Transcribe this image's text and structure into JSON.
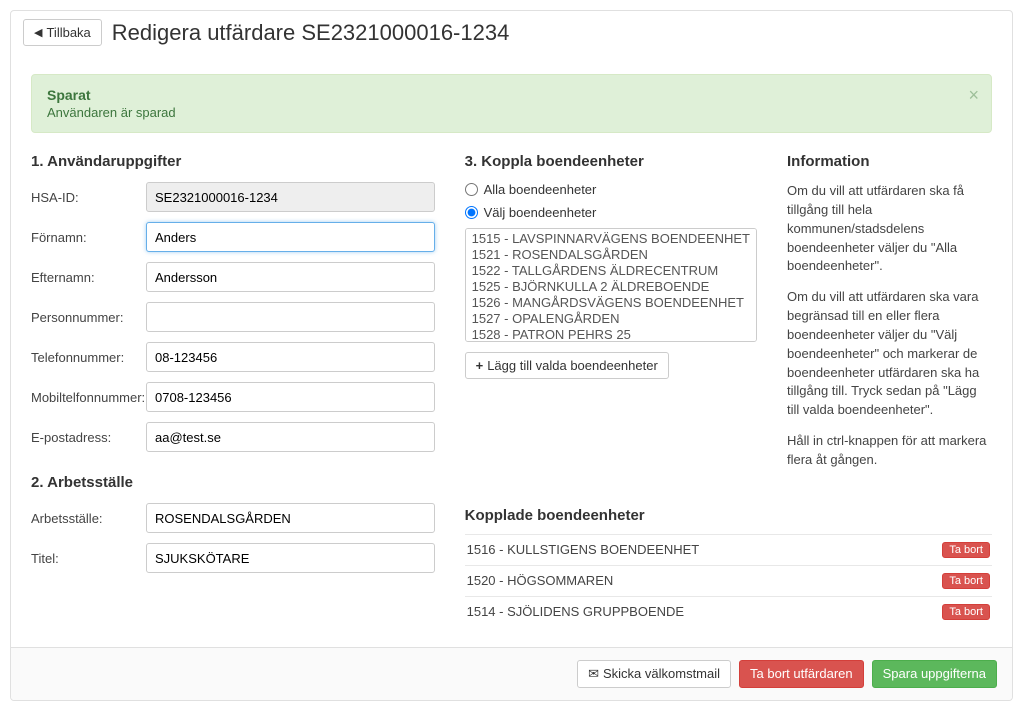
{
  "header": {
    "back_label": "Tillbaka",
    "title": "Redigera utfärdare SE2321000016-1234"
  },
  "alert": {
    "title": "Sparat",
    "text": "Användaren är sparad"
  },
  "section1": {
    "heading": "1. Användaruppgifter",
    "hsaid_label": "HSA-ID:",
    "hsaid_value": "SE2321000016-1234",
    "firstname_label": "Förnamn:",
    "firstname_value": "Anders",
    "lastname_label": "Efternamn:",
    "lastname_value": "Andersson",
    "personnr_label": "Personnummer:",
    "personnr_value": "",
    "phone_label": "Telefonnummer:",
    "phone_value": "08-123456",
    "mobile_label": "Mobiltelfonnummer:",
    "mobile_value": "0708-123456",
    "email_label": "E-postadress:",
    "email_value": "aa@test.se"
  },
  "section2": {
    "heading": "2. Arbetsställe",
    "workplace_label": "Arbetsställe:",
    "workplace_value": "ROSENDALSGÅRDEN",
    "title_label": "Titel:",
    "title_value": "SJUKSKÖTARE"
  },
  "section3": {
    "heading": "3. Koppla boendeenheter",
    "radio_all": "Alla boendeenheter",
    "radio_select": "Välj boendeenheter",
    "options": [
      "1515 - LAVSPINNARVÄGENS BOENDEENHET",
      "1521 - ROSENDALSGÅRDEN",
      "1522 - TALLGÅRDENS ÄLDRECENTRUM",
      "1525 - BJÖRNKULLA 2 ÄLDREBOENDE",
      "1526 - MANGÅRDSVÄGENS BOENDEENHET",
      "1527 - OPALENGÅRDEN",
      "1528 - PATRON PEHRS 25"
    ],
    "add_button": "Lägg till valda boendeenheter"
  },
  "info": {
    "heading": "Information",
    "p1": "Om du vill att utfärdaren ska få tillgång till hela kommunen/stadsdelens boendeenheter väljer du \"Alla boendeenheter\".",
    "p2": "Om du vill att utfärdaren ska vara begränsad till en eller flera boendeenheter väljer du \"Välj boendeenheter\" och markerar de boendeenheter utfärdaren ska ha tillgång till. Tryck sedan på \"Lägg till valda boendeenheter\".",
    "p3": "Håll in ctrl-knappen för att markera flera åt gången."
  },
  "linked": {
    "heading": "Kopplade boendeenheter",
    "remove_label": "Ta bort",
    "items": [
      "1516 - KULLSTIGENS BOENDEENHET",
      "1520 - HÖGSOMMAREN",
      "1514 - SJÖLIDENS GRUPPBOENDE"
    ]
  },
  "footer": {
    "send_welcome": "Skicka välkomstmail",
    "delete": "Ta bort utfärdaren",
    "save": "Spara uppgifterna"
  }
}
